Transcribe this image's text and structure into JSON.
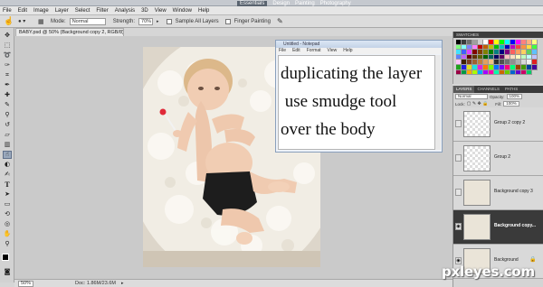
{
  "menu": [
    "File",
    "Edit",
    "Image",
    "Layer",
    "Select",
    "Filter",
    "Analysis",
    "3D",
    "View",
    "Window",
    "Help"
  ],
  "workspace": {
    "active": "Essentials",
    "items": [
      "Design",
      "Painting",
      "Photography"
    ]
  },
  "options": {
    "mode_label": "Mode:",
    "mode_value": "Normal",
    "strength_label": "Strength:",
    "strength_value": "70%",
    "sample_all_layers": "Sample All Layers",
    "finger_painting": "Finger Painting"
  },
  "document": {
    "tab": "BABY.psd @ 50% (Background copy 2, RGB/8) *",
    "zoom": "50%",
    "doc_info": "Doc: 1.86M/23.6M"
  },
  "notepad": {
    "title": "Untitled - Notepad",
    "menu": [
      "File",
      "Edit",
      "Format",
      "View",
      "Help"
    ],
    "lines": [
      "duplicating the layer",
      " use smudge tool",
      "over the body"
    ]
  },
  "panels": {
    "swatches_tab": "SWATCHES",
    "layers_tabs": [
      "LAYERS",
      "CHANNELS",
      "PATHS"
    ],
    "blend_mode": "Normal",
    "opacity_label": "Opacity:",
    "opacity_value": "100%",
    "lock_label": "Lock:",
    "fill_label": "Fill:",
    "fill_value": "100%"
  },
  "layers": [
    {
      "name": "Group 2 copy 2",
      "visible": false,
      "selected": false,
      "kind": "transparent"
    },
    {
      "name": "Group 2",
      "visible": false,
      "selected": false,
      "kind": "transparent"
    },
    {
      "name": "Background copy 3",
      "visible": false,
      "selected": false,
      "kind": "image"
    },
    {
      "name": "Background copy...",
      "visible": true,
      "selected": true,
      "kind": "image"
    },
    {
      "name": "Background",
      "visible": true,
      "selected": false,
      "kind": "image"
    }
  ],
  "swatch_colors": [
    "#000000",
    "#3a3a3a",
    "#6e6e6e",
    "#a0a0a0",
    "#d0d0d0",
    "#ffffff",
    "#ff0000",
    "#ffff00",
    "#00ff00",
    "#00ffff",
    "#0000ff",
    "#ff00ff",
    "#ff8080",
    "#ffb080",
    "#ffff80",
    "#80ff80",
    "#80ffff",
    "#8080ff",
    "#ff80ff",
    "#c00000",
    "#c06000",
    "#c0c000",
    "#00c000",
    "#00c0c0",
    "#0000c0",
    "#c000c0",
    "#ff4040",
    "#ff9040",
    "#ffe040",
    "#40ff40",
    "#40e0ff",
    "#4060ff",
    "#e040ff",
    "#800000",
    "#804000",
    "#808000",
    "#008000",
    "#008080",
    "#000080",
    "#800080",
    "#ff6060",
    "#ffa060",
    "#ffd060",
    "#60d060",
    "#60c0ff",
    "#6080ff",
    "#c060ff",
    "#600000",
    "#603000",
    "#606000",
    "#006000",
    "#006060",
    "#000060",
    "#600060",
    "#ffc0c0",
    "#ffe0c0",
    "#ffffc0",
    "#c0ffc0",
    "#c0ffff",
    "#c0c0ff",
    "#ffc0ff",
    "#402000",
    "#804020",
    "#a06030",
    "#c08040",
    "#e0a060",
    "#f0c080",
    "#303030",
    "#505050",
    "#707070",
    "#909090",
    "#b0b0b0",
    "#d8d8d8",
    "#f0f0f0",
    "#e02020",
    "#20a020",
    "#2020e0",
    "#e0e020",
    "#20e0e0",
    "#e020e0",
    "#ff7700",
    "#77ff00",
    "#0077ff",
    "#7700ff",
    "#ff0077",
    "#00ff77",
    "#994400",
    "#449900",
    "#004499",
    "#440099",
    "#990044",
    "#009944",
    "#ffaa00",
    "#aaff00",
    "#00aaff",
    "#aa00ff",
    "#ff00aa",
    "#00ffaa",
    "#cc6600",
    "#66cc00",
    "#0066cc",
    "#6600cc",
    "#cc0066",
    "#00cc66"
  ],
  "watermark": "pxleyes.com"
}
